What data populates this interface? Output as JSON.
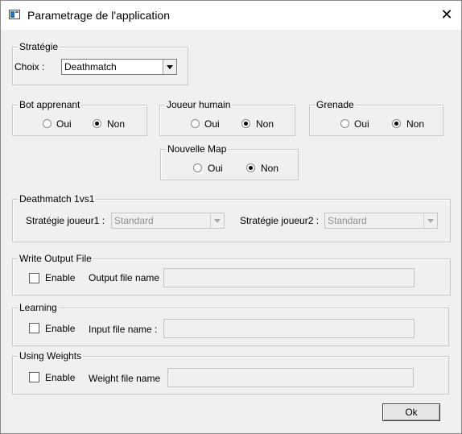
{
  "window": {
    "title": "Parametrage de l'application",
    "close_glyph": "✕"
  },
  "strategie": {
    "legend": "Stratégie",
    "choix_label": "Choix :",
    "choix_value": "Deathmatch"
  },
  "bot_apprenant": {
    "legend": "Bot apprenant",
    "oui": "Oui",
    "non": "Non",
    "selected": "Non"
  },
  "joueur_humain": {
    "legend": "Joueur humain",
    "oui": "Oui",
    "non": "Non",
    "selected": "Non"
  },
  "grenade": {
    "legend": "Grenade",
    "oui": "Oui",
    "non": "Non",
    "selected": "Non"
  },
  "nouvelle_map": {
    "legend": "Nouvelle Map",
    "oui": "Oui",
    "non": "Non",
    "selected": "Non"
  },
  "deathmatch": {
    "legend": "Deathmatch 1vs1",
    "joueur1_label": "Stratégie joueur1 :",
    "joueur1_value": "Standard",
    "joueur2_label": "Stratégie joueur2 :",
    "joueur2_value": "Standard"
  },
  "write_output": {
    "legend": "Write Output File",
    "enable_label": "Enable",
    "file_label": "Output file name",
    "file_value": ""
  },
  "learning": {
    "legend": "Learning",
    "enable_label": "Enable",
    "file_label": "Input file name :",
    "file_value": ""
  },
  "using_weights": {
    "legend": "Using Weights",
    "enable_label": "Enable",
    "file_label": "Weight file name",
    "file_value": ""
  },
  "ok_label": "Ok"
}
